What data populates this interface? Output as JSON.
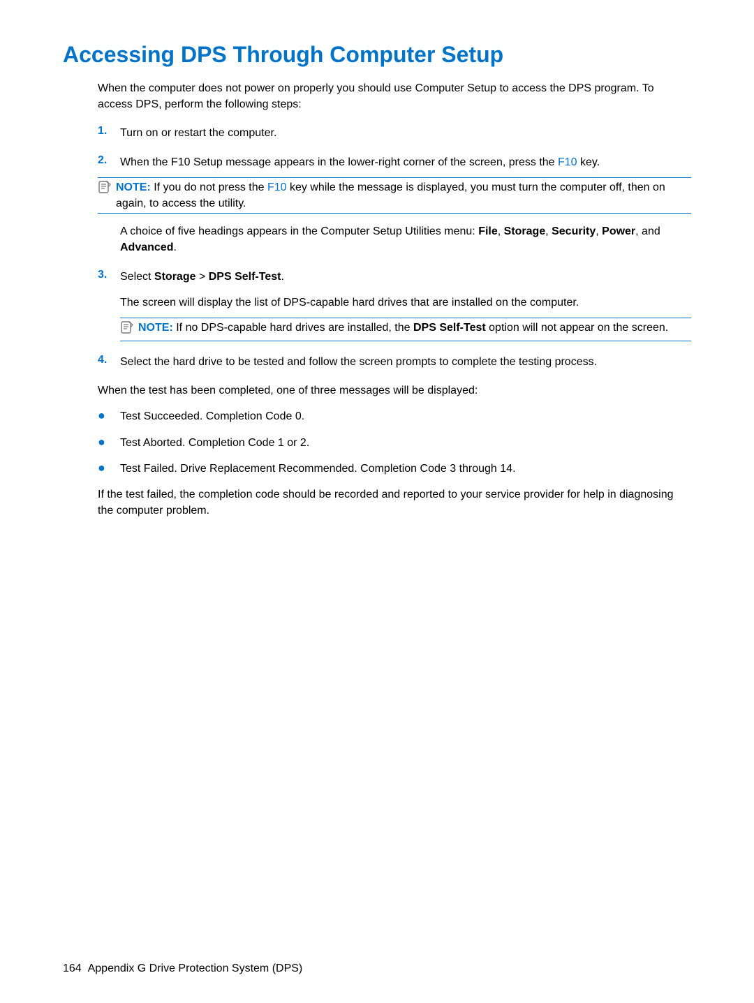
{
  "title": "Accessing DPS Through Computer Setup",
  "intro": "When the computer does not power on properly you should use Computer Setup to access the DPS program. To access DPS, perform the following steps:",
  "steps": {
    "s1": {
      "num": "1.",
      "text": "Turn on or restart the computer."
    },
    "s2": {
      "num": "2.",
      "pre": "When the F10 Setup message appears in the lower-right corner of the screen, press the ",
      "key": "F10",
      "post": " key."
    },
    "note1": {
      "label": "NOTE:",
      "pre": "   If you do not press the ",
      "key": "F10",
      "post": " key while the message is displayed, you must turn the computer off, then on again, to access the utility."
    },
    "s2b_pre": "A choice of five headings appears in the Computer Setup Utilities menu: ",
    "s2b_file": "File",
    "s2b_c1": ", ",
    "s2b_storage": "Storage",
    "s2b_c2": ", ",
    "s2b_security": "Security",
    "s2b_c3": ", ",
    "s2b_power": "Power",
    "s2b_c4": ", and ",
    "s2b_advanced": "Advanced",
    "s2b_end": ".",
    "s3": {
      "num": "3.",
      "pre": "Select ",
      "b1": "Storage",
      "mid": "  > ",
      "b2": "DPS Self-Test",
      "post": "."
    },
    "s3b": "The screen will display the list of DPS-capable hard drives that are installed on the computer.",
    "note2": {
      "label": "NOTE:",
      "pre": "   If no DPS-capable hard drives are installed, the ",
      "bold": "DPS Self-Test",
      "post": " option will not appear on the screen."
    },
    "s4": {
      "num": "4.",
      "text": "Select the hard drive to be tested and follow the screen prompts to complete the testing process."
    }
  },
  "after": "When the test has been completed, one of three messages will be displayed:",
  "bullets": {
    "b1": "Test Succeeded. Completion Code 0.",
    "b2": "Test Aborted. Completion Code 1 or 2.",
    "b3": "Test Failed. Drive Replacement Recommended. Completion Code 3 through 14."
  },
  "closing": "If the test failed, the completion code should be recorded and reported to your service provider for help in diagnosing the computer problem.",
  "footer": {
    "page": "164",
    "appendix": "Appendix G   Drive Protection System (DPS)"
  }
}
